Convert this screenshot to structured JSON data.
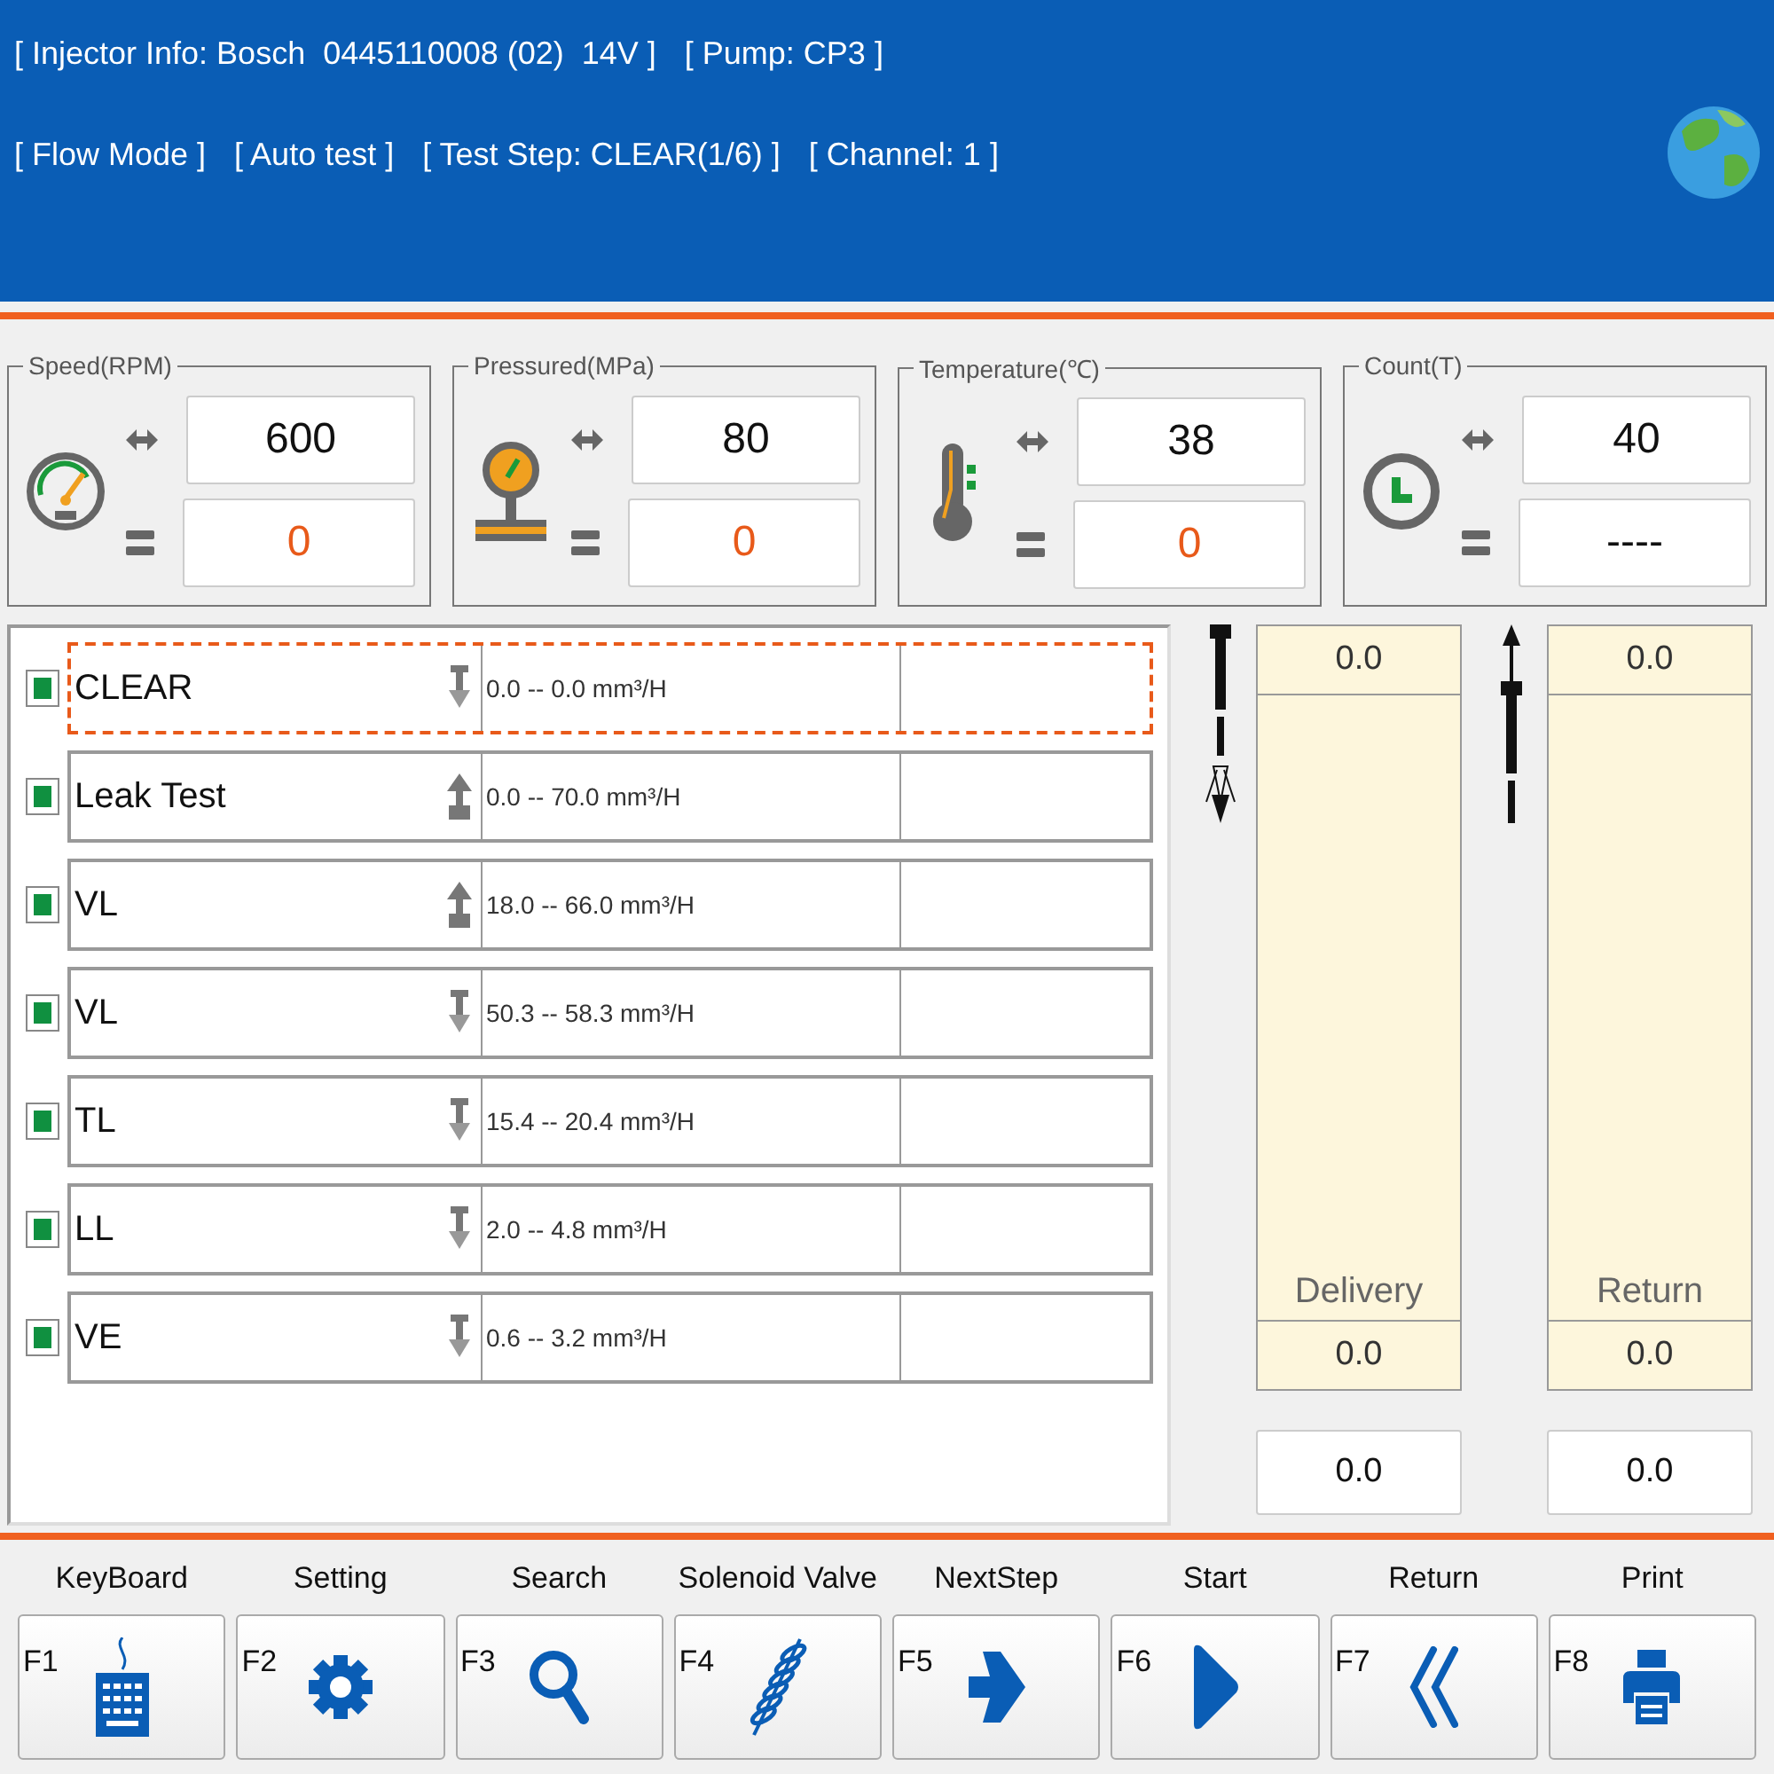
{
  "header": {
    "line_1": [
      "[ Injector Info: Bosch  0445110008 (02)  14V ]",
      "[ Pump: CP3 ]"
    ],
    "line_2": [
      "[ Flow Mode ]",
      "[ Auto test ]",
      "[ Test Step: CLEAR(1/6) ]",
      "[ Channel: 1 ]"
    ]
  },
  "gauges": [
    {
      "kind": "speed",
      "label": "Speed(RPM)",
      "set_value": "600",
      "actual_value": "0",
      "warn": true
    },
    {
      "kind": "pressure",
      "label": "Pressured(MPa)",
      "set_value": "80",
      "actual_value": "0",
      "warn": true
    },
    {
      "kind": "temperature",
      "label": "Temperature(℃)",
      "set_value": "38",
      "actual_value": "0",
      "warn": true
    },
    {
      "kind": "count",
      "label": "Count(T)",
      "set_value": "40",
      "actual_value": "----",
      "warn": false
    }
  ],
  "steps": [
    {
      "name": "CLEAR",
      "kind": "down",
      "range": "0.0 -- 0.0 mm³/H",
      "selected": true
    },
    {
      "name": "Leak Test",
      "kind": "up",
      "range": "0.0 -- 70.0 mm³/H",
      "selected": false
    },
    {
      "name": "VL",
      "kind": "up",
      "range": "18.0 -- 66.0 mm³/H",
      "selected": false
    },
    {
      "name": "VL",
      "kind": "down",
      "range": "50.3 -- 58.3 mm³/H",
      "selected": false
    },
    {
      "name": "TL",
      "kind": "down",
      "range": "15.4 -- 20.4 mm³/H",
      "selected": false
    },
    {
      "name": "LL",
      "kind": "down",
      "range": "2.0 -- 4.8 mm³/H",
      "selected": false
    },
    {
      "name": "VE",
      "kind": "down",
      "range": "0.6 -- 3.2 mm³/H",
      "selected": false
    }
  ],
  "meters": [
    {
      "kind": "delivery",
      "top_value": "0.0",
      "label": "Delivery",
      "bottom_value": "0.0",
      "field_value": "0.0"
    },
    {
      "kind": "return",
      "top_value": "0.0",
      "label": "Return",
      "bottom_value": "0.0",
      "field_value": "0.0"
    }
  ],
  "buttons": [
    {
      "key": "F1",
      "label": "KeyBoard",
      "kind": "keyboard"
    },
    {
      "key": "F2",
      "label": "Setting",
      "kind": "settings"
    },
    {
      "key": "F3",
      "label": "Search",
      "kind": "search"
    },
    {
      "key": "F4",
      "label": "Solenoid Valve",
      "kind": "coil"
    },
    {
      "key": "F5",
      "label": "NextStep",
      "kind": "arrow"
    },
    {
      "key": "F6",
      "label": "Start",
      "kind": "play"
    },
    {
      "key": "F7",
      "label": "Return",
      "kind": "back"
    },
    {
      "key": "F8",
      "label": "Print",
      "kind": "print"
    }
  ]
}
